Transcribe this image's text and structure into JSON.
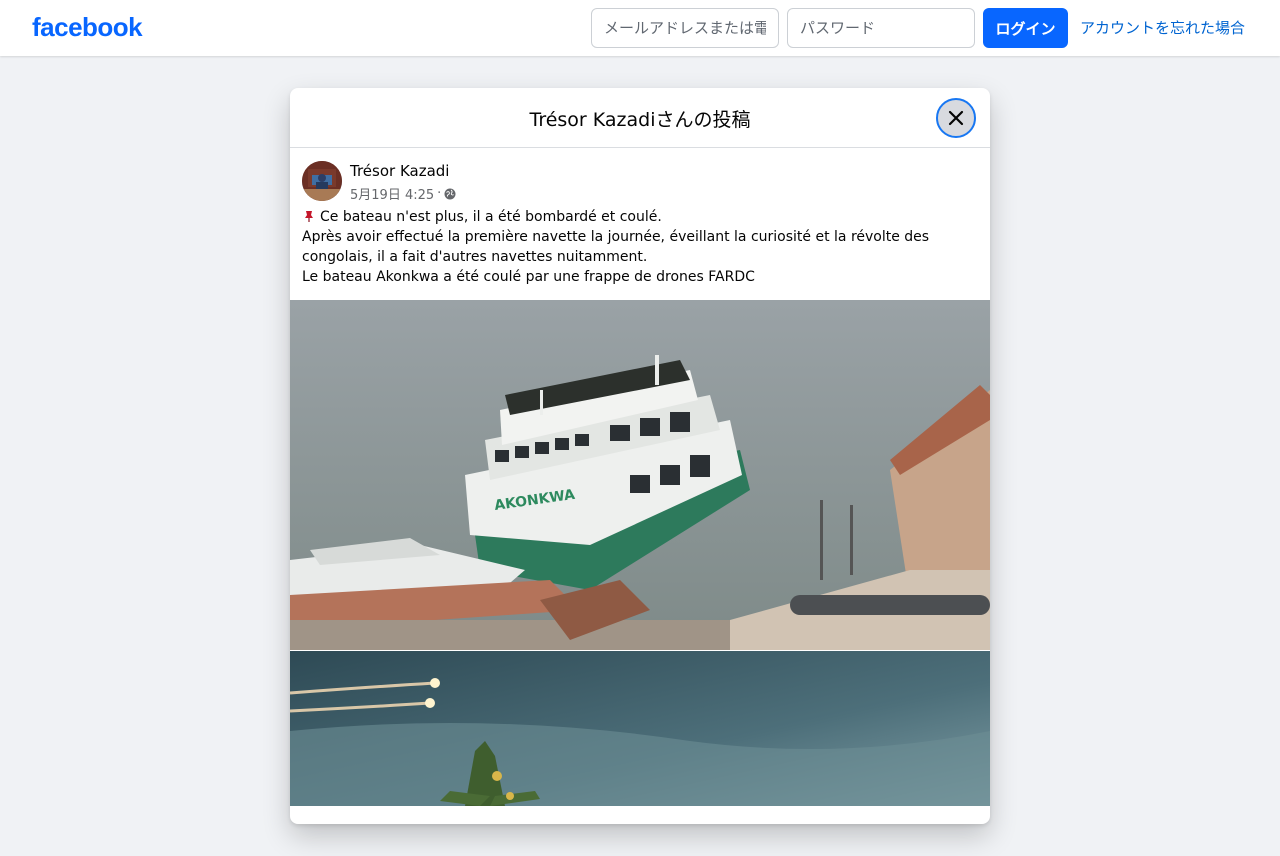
{
  "topbar": {
    "logo_text": "facebook",
    "email_placeholder": "メールアドレスまたは電話番号",
    "password_placeholder": "パスワード",
    "login_label": "ログイン",
    "forgot_label": "アカウントを忘れた場合"
  },
  "modal": {
    "title": "Trésor Kazadiさんの投稿",
    "close_icon": "close-icon"
  },
  "post": {
    "author": "Trésor Kazadi",
    "timestamp": "5月19日 4:25",
    "separator": "·",
    "privacy_icon": "globe-icon",
    "text_lines": [
      "Ce bateau n'est plus, il a été bombardé et coulé.",
      "Après avoir effectué la première navette la journée, éveillant la curiosité et la révolte des congolais, il a fait d'autres navettes nuitamment.",
      "Le bateau Akonkwa  a été coulé par une frappe de drones FARDC"
    ],
    "leading_icon": "pushpin-icon",
    "photo1_boat_name": "AKONKWA"
  },
  "colors": {
    "brand": "#0866ff",
    "link": "#0064d1",
    "background": "#f0f2f5"
  }
}
